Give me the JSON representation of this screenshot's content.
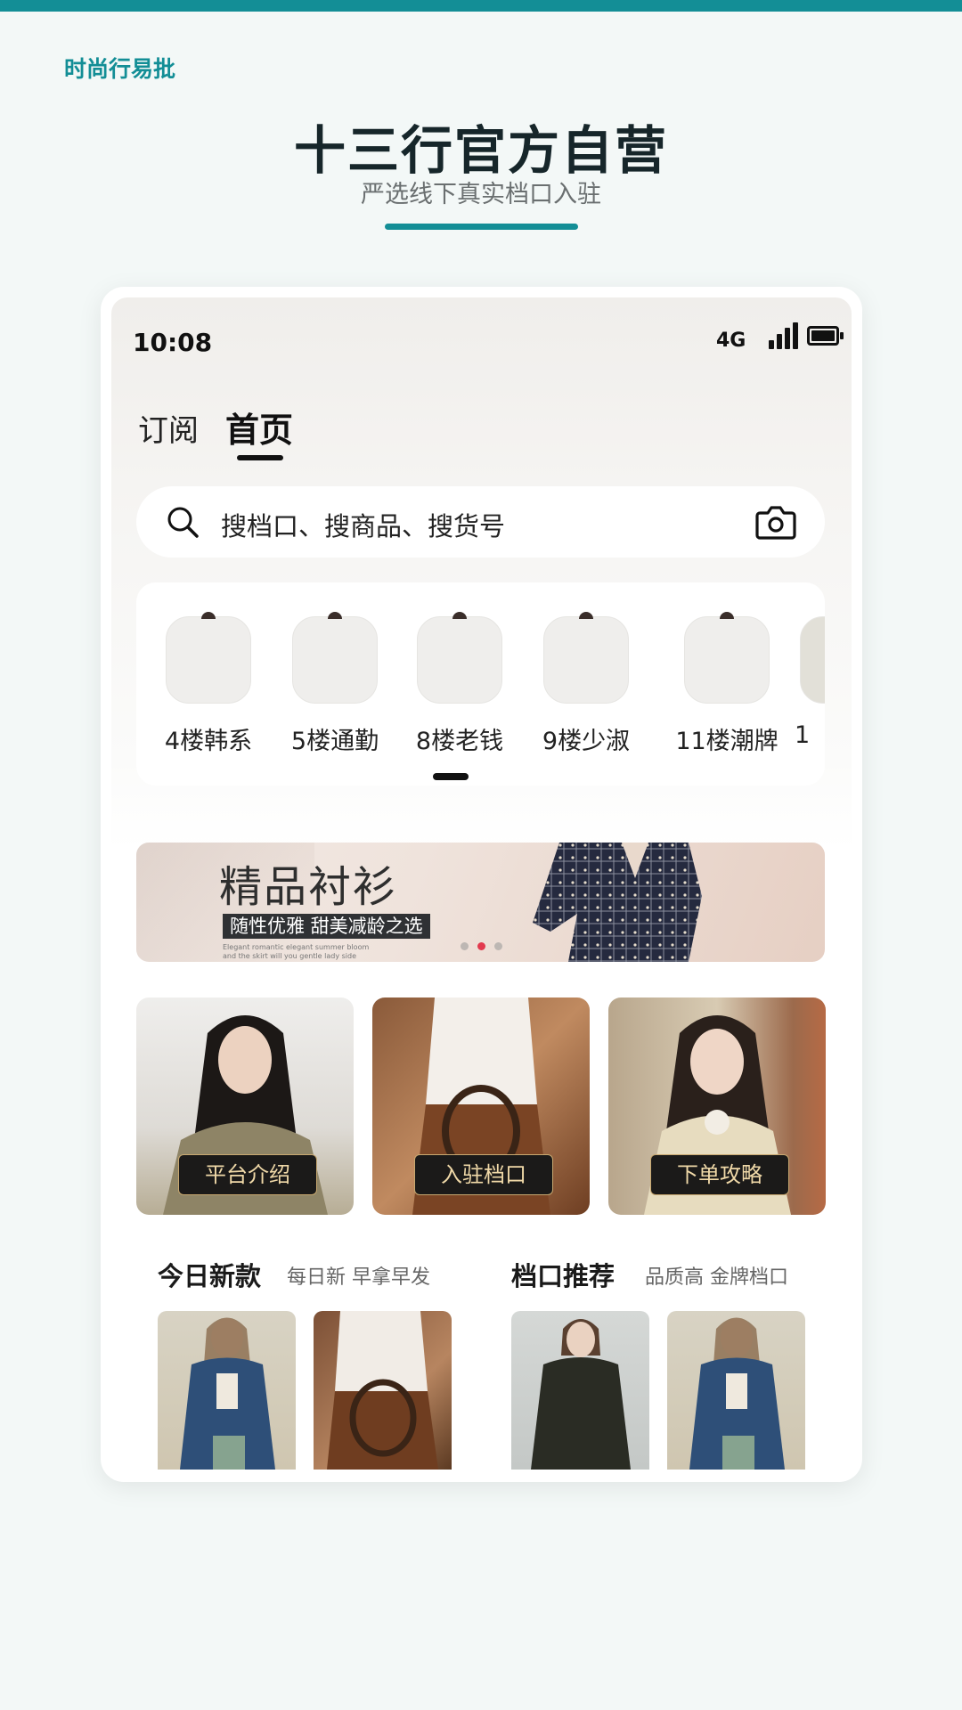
{
  "colors": {
    "accent": "#138e96",
    "background": "#f3f8f7",
    "gold": "#c8a870"
  },
  "brand": "时尚行易批",
  "headline": "十三行官方自营",
  "subline": "严选线下真实档口入驻",
  "status_bar": {
    "time": "10:08",
    "network": "4G",
    "icons": [
      "signal-icon",
      "battery-icon"
    ]
  },
  "tabs": [
    {
      "label": "订阅",
      "active": false
    },
    {
      "label": "首页",
      "active": true
    }
  ],
  "search": {
    "placeholder": "搜档口、搜商品、搜货号",
    "icons": [
      "search-icon",
      "camera-icon"
    ]
  },
  "floors": [
    {
      "label": "4楼韩系"
    },
    {
      "label": "5楼通勤"
    },
    {
      "label": "8楼老钱"
    },
    {
      "label": "9楼少淑"
    },
    {
      "label": "11楼潮牌"
    },
    {
      "label": "1"
    }
  ],
  "banner": {
    "title": "精品衬衫",
    "tagline": "随性优雅 甜美减龄之选",
    "fine_print": "Elegant romantic elegant summer bloom and the skirt will you gentle lady side shows",
    "carousel": {
      "count": 3,
      "active_index": 1
    }
  },
  "features": [
    {
      "label": "平台介绍"
    },
    {
      "label": "入驻档口"
    },
    {
      "label": "下单攻略"
    }
  ],
  "sections": [
    {
      "title": "今日新款",
      "subtitle": "每日新  早拿早发"
    },
    {
      "title": "档口推荐",
      "subtitle": "品质高 金牌档口"
    }
  ]
}
